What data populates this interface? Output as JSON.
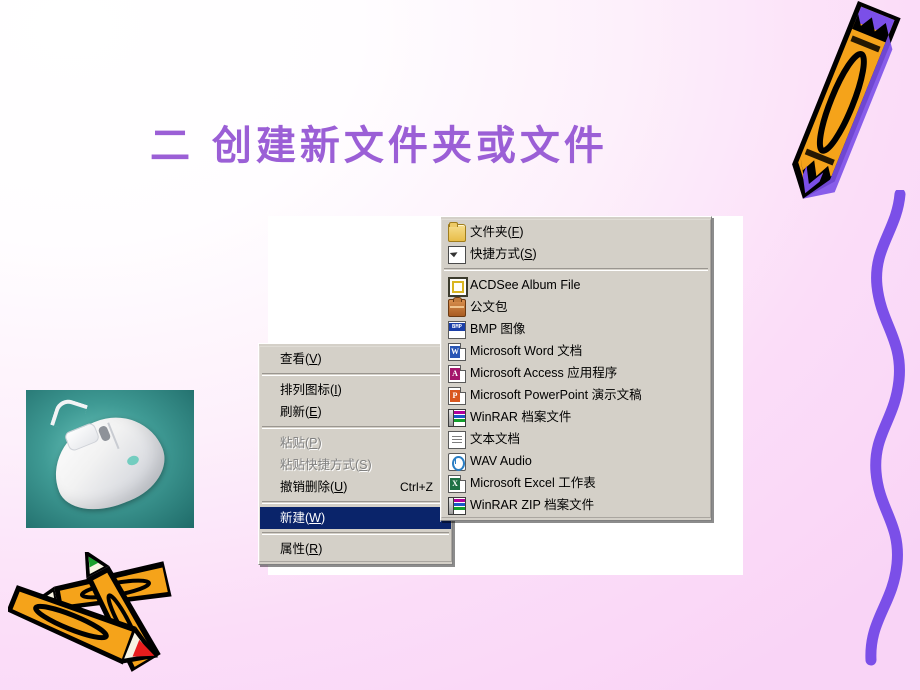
{
  "slide": {
    "title": "二 创建新文件夹或文件",
    "title_color": "#9b5fd6",
    "background_from": "#ffffff",
    "background_to": "#f9d4f6"
  },
  "decorations": {
    "top_right_pencil": "orange-pencil-purple-tip",
    "squiggle": "purple-wavy-line",
    "bottom_left_pencils": "crossed-orange-pencils-green-red-tips",
    "mouse_photo": "white-computer-mouse-on-teal-background"
  },
  "context_menu": {
    "name": "desktop-context-menu",
    "highlight_color": "#0a246a",
    "items": [
      {
        "label": "查看(V)",
        "mnemonic": "V",
        "submenu": true,
        "disabled": false,
        "selected": false,
        "accel": ""
      },
      {
        "separator": true
      },
      {
        "label": "排列图标(I)",
        "mnemonic": "I",
        "submenu": true,
        "disabled": false,
        "selected": false,
        "accel": ""
      },
      {
        "label": "刷新(E)",
        "mnemonic": "E",
        "submenu": false,
        "disabled": false,
        "selected": false,
        "accel": ""
      },
      {
        "separator": true
      },
      {
        "label": "粘贴(P)",
        "mnemonic": "P",
        "submenu": false,
        "disabled": true,
        "selected": false,
        "accel": ""
      },
      {
        "label": "粘贴快捷方式(S)",
        "mnemonic": "S",
        "submenu": false,
        "disabled": true,
        "selected": false,
        "accel": ""
      },
      {
        "label": "撤销删除(U)",
        "mnemonic": "U",
        "submenu": false,
        "disabled": false,
        "selected": false,
        "accel": "Ctrl+Z"
      },
      {
        "separator": true
      },
      {
        "label": "新建(W)",
        "mnemonic": "W",
        "submenu": true,
        "disabled": false,
        "selected": true,
        "accel": ""
      },
      {
        "separator": true
      },
      {
        "label": "属性(R)",
        "mnemonic": "R",
        "submenu": false,
        "disabled": false,
        "selected": false,
        "accel": ""
      }
    ]
  },
  "new_submenu": {
    "name": "new-item-submenu",
    "items": [
      {
        "label": "文件夹(F)",
        "mnemonic": "F",
        "icon": "folder-icon"
      },
      {
        "label": "快捷方式(S)",
        "mnemonic": "S",
        "icon": "shortcut-icon"
      },
      {
        "separator": true
      },
      {
        "label": "ACDSee Album File",
        "mnemonic": "",
        "icon": "acdsee-icon"
      },
      {
        "label": "公文包",
        "mnemonic": "",
        "icon": "briefcase-icon"
      },
      {
        "label": "BMP 图像",
        "mnemonic": "",
        "icon": "bmp-image-icon"
      },
      {
        "label": "Microsoft Word 文档",
        "mnemonic": "",
        "icon": "word-document-icon"
      },
      {
        "label": "Microsoft Access 应用程序",
        "mnemonic": "",
        "icon": "access-database-icon"
      },
      {
        "label": "Microsoft PowerPoint 演示文稿",
        "mnemonic": "",
        "icon": "powerpoint-icon"
      },
      {
        "label": "WinRAR 档案文件",
        "mnemonic": "",
        "icon": "winrar-archive-icon"
      },
      {
        "label": "文本文档",
        "mnemonic": "",
        "icon": "text-document-icon"
      },
      {
        "label": "WAV Audio",
        "mnemonic": "",
        "icon": "wav-audio-icon"
      },
      {
        "label": "Microsoft Excel 工作表",
        "mnemonic": "",
        "icon": "excel-worksheet-icon"
      },
      {
        "label": "WinRAR ZIP 档案文件",
        "mnemonic": "",
        "icon": "winrar-zip-icon"
      }
    ]
  }
}
